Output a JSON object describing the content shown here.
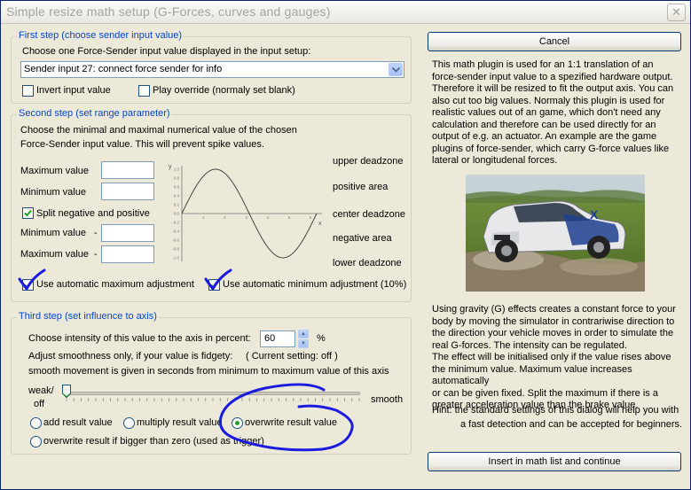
{
  "window": {
    "title": "Simple resize math setup (G-Forces, curves and gauges)",
    "close_glyph": "✕"
  },
  "step1": {
    "legend": "First step (choose sender input value)",
    "instruction": "Choose one Force-Sender input value displayed in the input setup:",
    "combo_value": "Sender input 27: connect force sender for info",
    "invert_label": "Invert input value",
    "invert_checked": false,
    "play_override_label": "Play override (normaly set blank)",
    "play_override_checked": false
  },
  "step2": {
    "legend": "Second step (set range parameter)",
    "desc_line1": "Choose the minimal and maximal numerical value of the chosen",
    "desc_line2": "Force-Sender input value. This will prevent spike values.",
    "max_label": "Maximum value",
    "min_label": "Minimum value",
    "split_label": "Split negative and positive",
    "split_checked": true,
    "neg_min_label": "Minimum value",
    "neg_max_label": "Maximum value",
    "neg_dash": "-",
    "zone_upper": "upper deadzone",
    "zone_positive": "positive area",
    "zone_center": "center deadzone",
    "zone_negative": "negative area",
    "zone_lower": "lower deadzone",
    "auto_max_label": "Use automatic maximum adjustment",
    "auto_max_checked": true,
    "auto_min_label": "Use automatic minimum adjustment (10%)",
    "auto_min_checked": true,
    "graph": {
      "y_axis_label": "y",
      "x_axis_label": "x",
      "y_ticks": [
        "1.0",
        "0.8",
        "0.6",
        "0.4",
        "0.2",
        "0.0",
        "-0.2",
        "-0.4",
        "-0.6",
        "-0.8",
        "-1.0"
      ],
      "x_ticks": [
        "1",
        "2",
        "3",
        "4",
        "5",
        "6"
      ],
      "curve_color": "#333333"
    }
  },
  "step3": {
    "legend": "Third step (set influence to axis)",
    "intensity_label": "Choose intensity of this value to the axis in percent:",
    "intensity_value": "60",
    "percent_sign": "%",
    "smooth_line1": "Adjust smoothness only, if your value is fidgety:",
    "current_setting": "( Current setting: off )",
    "smooth_line2": "smooth movement is given in seconds from minimum to maximum value of this axis",
    "weak_label_1": "weak/",
    "weak_label_2": "off",
    "smooth_label": "smooth",
    "slider_level": 0,
    "opt_add": "add result value",
    "opt_multiply": "multiply result value",
    "opt_overwrite": "overwrite result value",
    "opt_overwrite_bigger": "overwrite result if bigger than zero (used as trigger)",
    "selected_option": "overwrite result value"
  },
  "right": {
    "cancel_label": "Cancel",
    "info_lines": [
      "This math plugin is used for an 1:1 translation of an",
      "force-sender input value to a spezified hardware output.",
      "Therefore it will be resized to fit the output axis. You can",
      "also cut too big values. Normaly this plugin is used for",
      "realistic values out of an game, which don't need any",
      "calculation and therefore can be used directly for an",
      "output of e.g. an actuator. An example are the game",
      "plugins of force-sender, which carry G-force values like",
      "lateral or longitudenal forces."
    ],
    "gravity_lines": [
      "Using gravity (G) effects creates a constant force to your",
      "body by moving the simulator in contrariwise direction to",
      "the direction your vehicle moves in order to simulate the",
      "real G-forces. The intensity can be regulated.",
      "The effect will be initialised only if the value rises above",
      "the minimum value. Maximum value increases automatically",
      "or can be given fixed. Split the maximum if there is a",
      "greater acceleration value than the brake value."
    ],
    "hint_line1": "Hint: the standard settings of this dialog will help you with",
    "hint_line2": "a fast detection and can be accepted for beginners.",
    "insert_label": "Insert in math list and continue"
  },
  "colors": {
    "legend": "#0046d5",
    "annotation": "#1a1ae0",
    "check": "#21a121"
  }
}
